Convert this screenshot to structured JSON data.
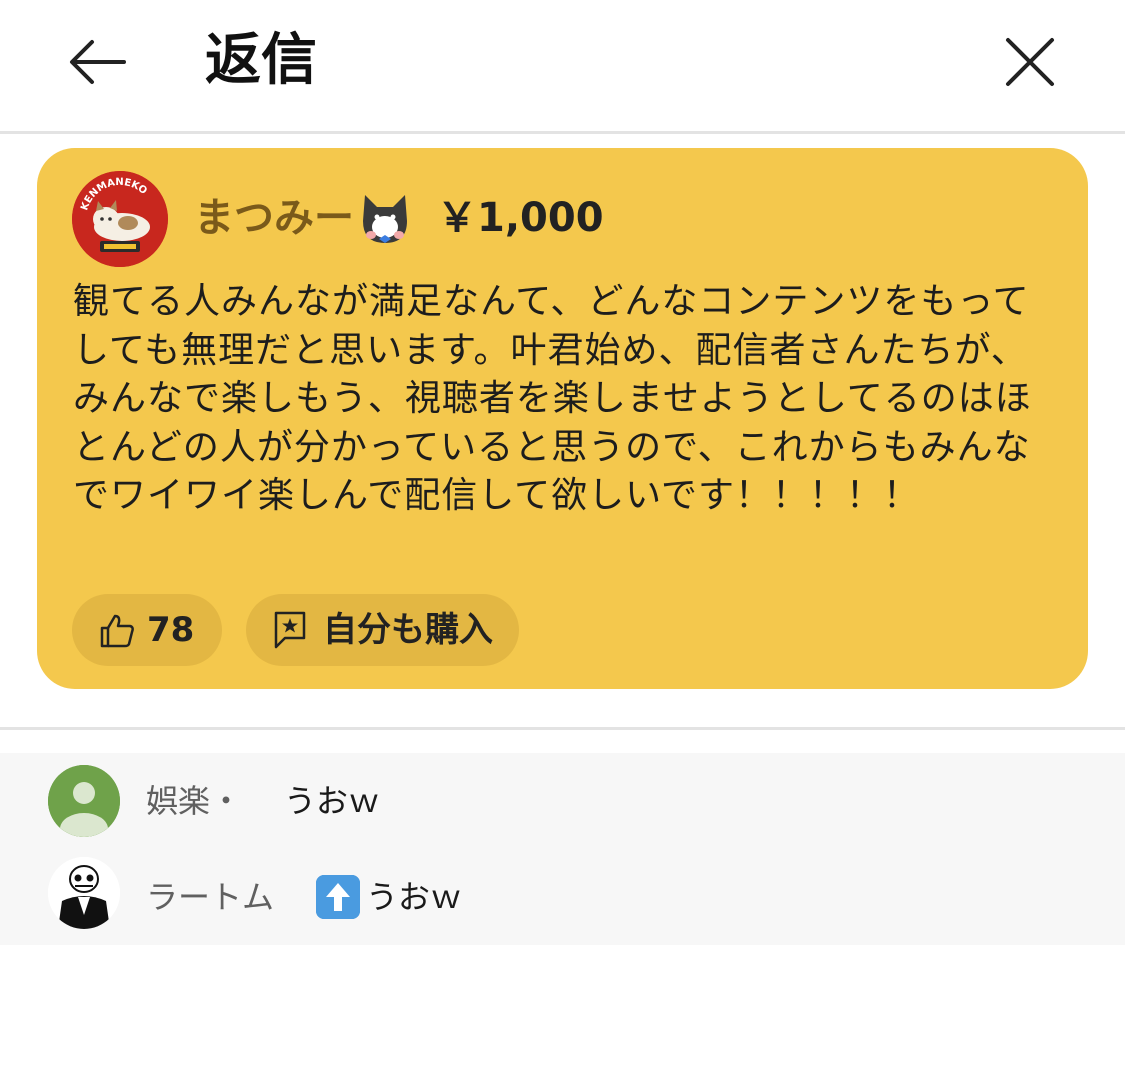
{
  "header": {
    "title": "返信",
    "back_icon": "arrow-left-icon",
    "close_icon": "close-icon"
  },
  "superchat": {
    "username": "まつみー",
    "amount": "￥1,000",
    "message": "観てる人みんなが満足なんて、どんなコンテンツをもってしても無理だと思います。叶君始め、配信者さんたちが、みんなで楽しもう、視聴者を楽しませようとしてるのはほとんどの人が分かっていると思うので、これからもみんなでワイワイ楽しんで配信して欲しいです！！！！！",
    "avatar_text": "KENMANEKO",
    "like_count": "78",
    "buy_label": "自分も購入",
    "card_color": "#f4c84d"
  },
  "replies": [
    {
      "name": "娯楽・",
      "text": "うおｗ"
    },
    {
      "name": "ラートム",
      "text": "うおｗ"
    }
  ]
}
